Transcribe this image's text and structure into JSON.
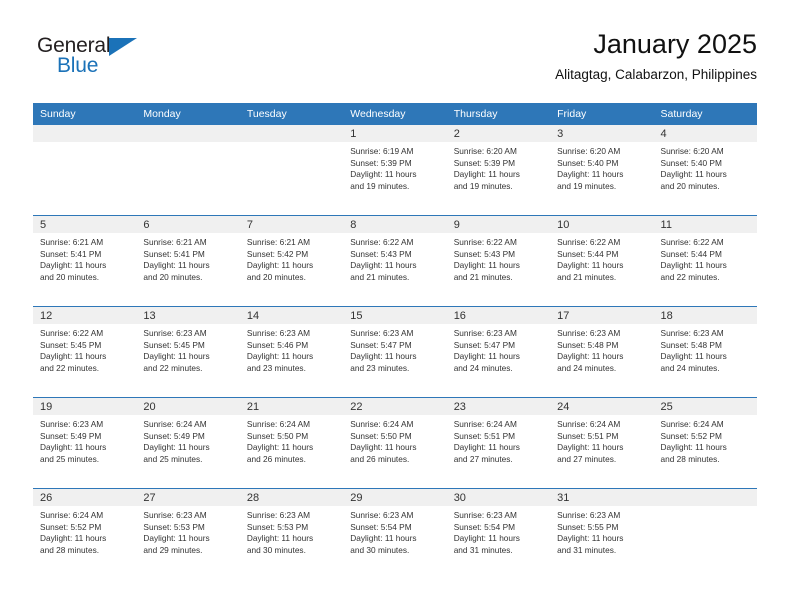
{
  "brand": {
    "name_top": "General",
    "name_bottom": "Blue",
    "accent_color": "#1b72b8",
    "triangle_icon": "triangle-right-icon"
  },
  "header": {
    "title": "January 2025",
    "subtitle": "Alitagtag, Calabarzon, Philippines"
  },
  "calendar": {
    "header_bg": "#2e77b8",
    "daynum_bg": "#f0f0f0",
    "weekday_names": [
      "Sunday",
      "Monday",
      "Tuesday",
      "Wednesday",
      "Thursday",
      "Friday",
      "Saturday"
    ],
    "labels": {
      "sunrise": "Sunrise:",
      "sunset": "Sunset:",
      "daylight": "Daylight:"
    },
    "weeks": [
      [
        {
          "day": "",
          "sunrise": "",
          "sunset": "",
          "daylight_line1": "",
          "daylight_line2": ""
        },
        {
          "day": "",
          "sunrise": "",
          "sunset": "",
          "daylight_line1": "",
          "daylight_line2": ""
        },
        {
          "day": "",
          "sunrise": "",
          "sunset": "",
          "daylight_line1": "",
          "daylight_line2": ""
        },
        {
          "day": "1",
          "sunrise": "Sunrise: 6:19 AM",
          "sunset": "Sunset: 5:39 PM",
          "daylight_line1": "Daylight: 11 hours",
          "daylight_line2": "and 19 minutes."
        },
        {
          "day": "2",
          "sunrise": "Sunrise: 6:20 AM",
          "sunset": "Sunset: 5:39 PM",
          "daylight_line1": "Daylight: 11 hours",
          "daylight_line2": "and 19 minutes."
        },
        {
          "day": "3",
          "sunrise": "Sunrise: 6:20 AM",
          "sunset": "Sunset: 5:40 PM",
          "daylight_line1": "Daylight: 11 hours",
          "daylight_line2": "and 19 minutes."
        },
        {
          "day": "4",
          "sunrise": "Sunrise: 6:20 AM",
          "sunset": "Sunset: 5:40 PM",
          "daylight_line1": "Daylight: 11 hours",
          "daylight_line2": "and 20 minutes."
        }
      ],
      [
        {
          "day": "5",
          "sunrise": "Sunrise: 6:21 AM",
          "sunset": "Sunset: 5:41 PM",
          "daylight_line1": "Daylight: 11 hours",
          "daylight_line2": "and 20 minutes."
        },
        {
          "day": "6",
          "sunrise": "Sunrise: 6:21 AM",
          "sunset": "Sunset: 5:41 PM",
          "daylight_line1": "Daylight: 11 hours",
          "daylight_line2": "and 20 minutes."
        },
        {
          "day": "7",
          "sunrise": "Sunrise: 6:21 AM",
          "sunset": "Sunset: 5:42 PM",
          "daylight_line1": "Daylight: 11 hours",
          "daylight_line2": "and 20 minutes."
        },
        {
          "day": "8",
          "sunrise": "Sunrise: 6:22 AM",
          "sunset": "Sunset: 5:43 PM",
          "daylight_line1": "Daylight: 11 hours",
          "daylight_line2": "and 21 minutes."
        },
        {
          "day": "9",
          "sunrise": "Sunrise: 6:22 AM",
          "sunset": "Sunset: 5:43 PM",
          "daylight_line1": "Daylight: 11 hours",
          "daylight_line2": "and 21 minutes."
        },
        {
          "day": "10",
          "sunrise": "Sunrise: 6:22 AM",
          "sunset": "Sunset: 5:44 PM",
          "daylight_line1": "Daylight: 11 hours",
          "daylight_line2": "and 21 minutes."
        },
        {
          "day": "11",
          "sunrise": "Sunrise: 6:22 AM",
          "sunset": "Sunset: 5:44 PM",
          "daylight_line1": "Daylight: 11 hours",
          "daylight_line2": "and 22 minutes."
        }
      ],
      [
        {
          "day": "12",
          "sunrise": "Sunrise: 6:22 AM",
          "sunset": "Sunset: 5:45 PM",
          "daylight_line1": "Daylight: 11 hours",
          "daylight_line2": "and 22 minutes."
        },
        {
          "day": "13",
          "sunrise": "Sunrise: 6:23 AM",
          "sunset": "Sunset: 5:45 PM",
          "daylight_line1": "Daylight: 11 hours",
          "daylight_line2": "and 22 minutes."
        },
        {
          "day": "14",
          "sunrise": "Sunrise: 6:23 AM",
          "sunset": "Sunset: 5:46 PM",
          "daylight_line1": "Daylight: 11 hours",
          "daylight_line2": "and 23 minutes."
        },
        {
          "day": "15",
          "sunrise": "Sunrise: 6:23 AM",
          "sunset": "Sunset: 5:47 PM",
          "daylight_line1": "Daylight: 11 hours",
          "daylight_line2": "and 23 minutes."
        },
        {
          "day": "16",
          "sunrise": "Sunrise: 6:23 AM",
          "sunset": "Sunset: 5:47 PM",
          "daylight_line1": "Daylight: 11 hours",
          "daylight_line2": "and 24 minutes."
        },
        {
          "day": "17",
          "sunrise": "Sunrise: 6:23 AM",
          "sunset": "Sunset: 5:48 PM",
          "daylight_line1": "Daylight: 11 hours",
          "daylight_line2": "and 24 minutes."
        },
        {
          "day": "18",
          "sunrise": "Sunrise: 6:23 AM",
          "sunset": "Sunset: 5:48 PM",
          "daylight_line1": "Daylight: 11 hours",
          "daylight_line2": "and 24 minutes."
        }
      ],
      [
        {
          "day": "19",
          "sunrise": "Sunrise: 6:23 AM",
          "sunset": "Sunset: 5:49 PM",
          "daylight_line1": "Daylight: 11 hours",
          "daylight_line2": "and 25 minutes."
        },
        {
          "day": "20",
          "sunrise": "Sunrise: 6:24 AM",
          "sunset": "Sunset: 5:49 PM",
          "daylight_line1": "Daylight: 11 hours",
          "daylight_line2": "and 25 minutes."
        },
        {
          "day": "21",
          "sunrise": "Sunrise: 6:24 AM",
          "sunset": "Sunset: 5:50 PM",
          "daylight_line1": "Daylight: 11 hours",
          "daylight_line2": "and 26 minutes."
        },
        {
          "day": "22",
          "sunrise": "Sunrise: 6:24 AM",
          "sunset": "Sunset: 5:50 PM",
          "daylight_line1": "Daylight: 11 hours",
          "daylight_line2": "and 26 minutes."
        },
        {
          "day": "23",
          "sunrise": "Sunrise: 6:24 AM",
          "sunset": "Sunset: 5:51 PM",
          "daylight_line1": "Daylight: 11 hours",
          "daylight_line2": "and 27 minutes."
        },
        {
          "day": "24",
          "sunrise": "Sunrise: 6:24 AM",
          "sunset": "Sunset: 5:51 PM",
          "daylight_line1": "Daylight: 11 hours",
          "daylight_line2": "and 27 minutes."
        },
        {
          "day": "25",
          "sunrise": "Sunrise: 6:24 AM",
          "sunset": "Sunset: 5:52 PM",
          "daylight_line1": "Daylight: 11 hours",
          "daylight_line2": "and 28 minutes."
        }
      ],
      [
        {
          "day": "26",
          "sunrise": "Sunrise: 6:24 AM",
          "sunset": "Sunset: 5:52 PM",
          "daylight_line1": "Daylight: 11 hours",
          "daylight_line2": "and 28 minutes."
        },
        {
          "day": "27",
          "sunrise": "Sunrise: 6:23 AM",
          "sunset": "Sunset: 5:53 PM",
          "daylight_line1": "Daylight: 11 hours",
          "daylight_line2": "and 29 minutes."
        },
        {
          "day": "28",
          "sunrise": "Sunrise: 6:23 AM",
          "sunset": "Sunset: 5:53 PM",
          "daylight_line1": "Daylight: 11 hours",
          "daylight_line2": "and 30 minutes."
        },
        {
          "day": "29",
          "sunrise": "Sunrise: 6:23 AM",
          "sunset": "Sunset: 5:54 PM",
          "daylight_line1": "Daylight: 11 hours",
          "daylight_line2": "and 30 minutes."
        },
        {
          "day": "30",
          "sunrise": "Sunrise: 6:23 AM",
          "sunset": "Sunset: 5:54 PM",
          "daylight_line1": "Daylight: 11 hours",
          "daylight_line2": "and 31 minutes."
        },
        {
          "day": "31",
          "sunrise": "Sunrise: 6:23 AM",
          "sunset": "Sunset: 5:55 PM",
          "daylight_line1": "Daylight: 11 hours",
          "daylight_line2": "and 31 minutes."
        },
        {
          "day": "",
          "sunrise": "",
          "sunset": "",
          "daylight_line1": "",
          "daylight_line2": ""
        }
      ]
    ]
  }
}
